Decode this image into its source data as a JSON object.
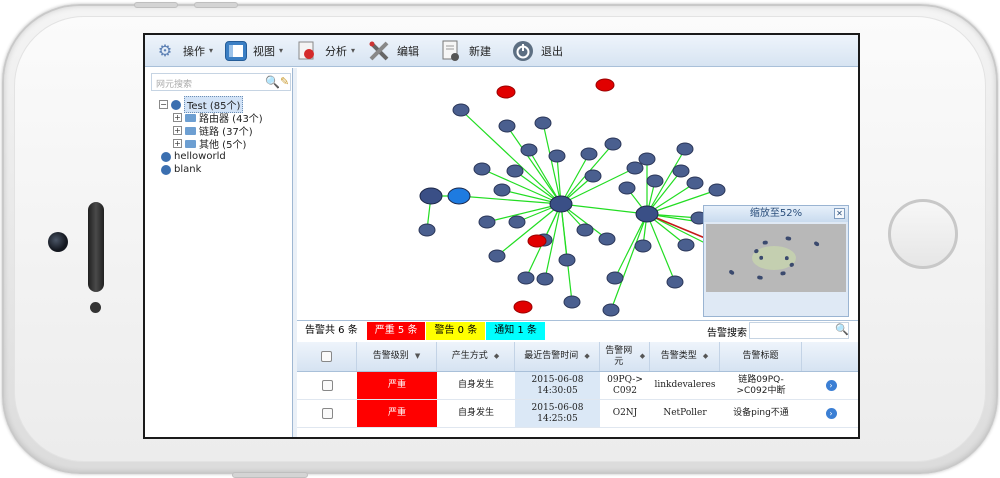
{
  "toolbar": {
    "items": [
      {
        "label": "操作",
        "icon": "gear-icon",
        "has_menu": true
      },
      {
        "label": "视图",
        "icon": "view-layout-icon",
        "has_menu": true
      },
      {
        "label": "分析",
        "icon": "analysis-icon",
        "has_menu": true
      },
      {
        "label": "编辑",
        "icon": "edit-tools-icon",
        "has_menu": false
      },
      {
        "label": "新建",
        "icon": "new-document-icon",
        "has_menu": false
      },
      {
        "label": "退出",
        "icon": "power-icon",
        "has_menu": false
      }
    ]
  },
  "tree": {
    "search_placeholder": "网元搜索",
    "root": "Test (85个)",
    "children": [
      "路由器 (43个)",
      "链路 (37个)",
      "其他 (5个)"
    ],
    "others": [
      "helloworld",
      "blank"
    ]
  },
  "overview": {
    "title": "缩放至52%"
  },
  "alarm_bar": {
    "total": "告警共 6 条",
    "critical": "严重 5 条",
    "warning": "警告 0 条",
    "notice": "通知 1 条",
    "search_label": "告警搜索",
    "colors": {
      "critical": "#ff0000",
      "warning": "#ffff00",
      "notice": "#00ffff"
    }
  },
  "table": {
    "headers": [
      "告警级别",
      "产生方式",
      "最近告警时间",
      "告警网元",
      "告警类型",
      "告警标题"
    ],
    "rows": [
      {
        "level": "严重",
        "source": "自身发生",
        "time": "2015-06-08 14:30:05",
        "ne": "09PQ->C092",
        "type": "linkdevaleres",
        "title": "链路09PQ->C092中断"
      },
      {
        "level": "严重",
        "source": "自身发生",
        "time": "2015-06-08 14:25:05",
        "ne": "O2NJ",
        "type": "NetPoller",
        "title": "设备ping不通"
      }
    ]
  }
}
